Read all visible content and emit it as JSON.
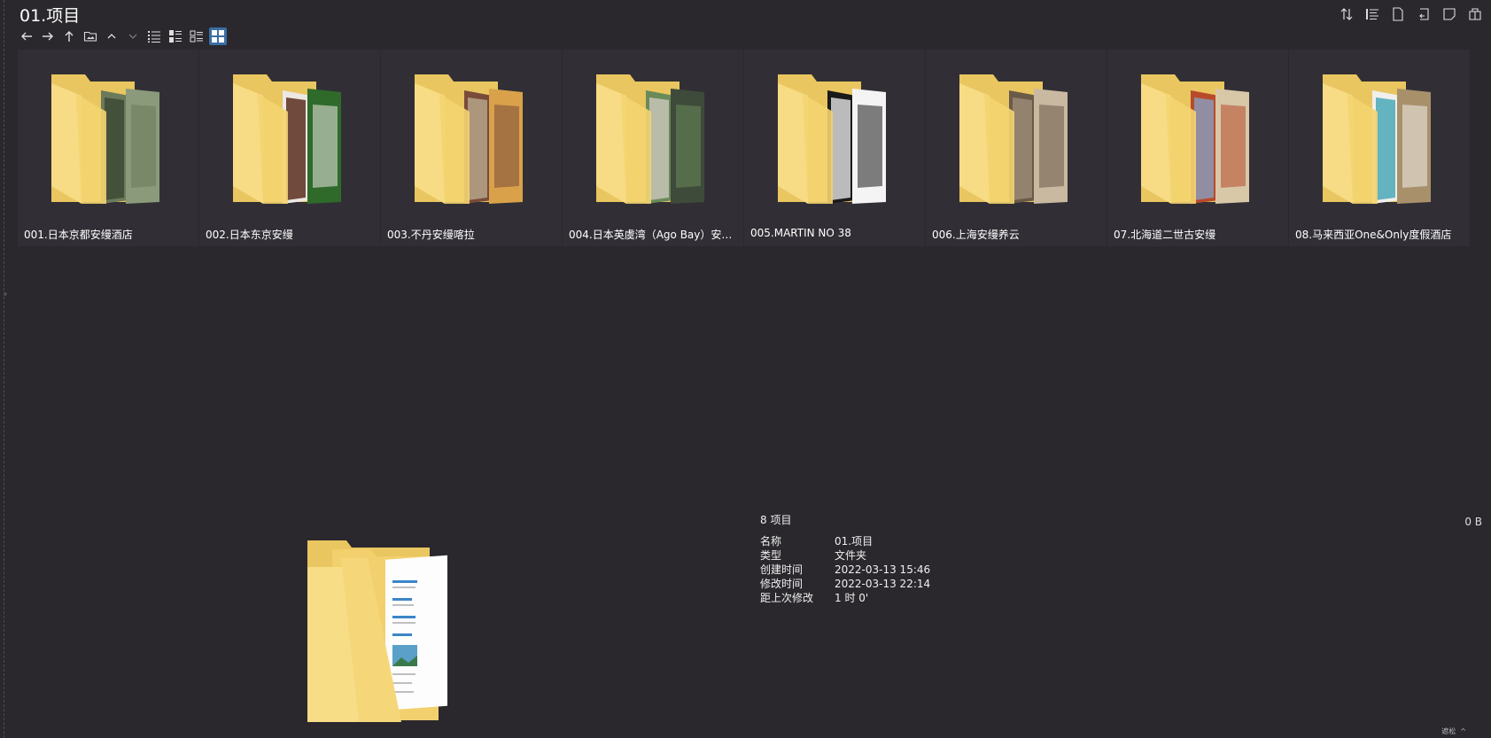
{
  "window": {
    "title": "01.项目"
  },
  "toolbar": {
    "nav_icons": [
      "back-arrow-icon",
      "forward-arrow-icon",
      "up-arrow-icon",
      "folder-picture-icon",
      "chevron-up-icon",
      "chevron-down-icon",
      "list-view-icon",
      "details-view-icon",
      "tiles-view-icon",
      "large-icons-view-icon"
    ],
    "right_icons": [
      "sort-icon",
      "properties-list-icon",
      "new-file-icon",
      "copy-path-icon",
      "note-icon",
      "package-icon"
    ]
  },
  "folders": [
    {
      "name": "001.日本京都安缦酒店",
      "colors": [
        "#6a7a5a",
        "#3d4a35",
        "#8a9a7a"
      ]
    },
    {
      "name": "002.日本东京安缦",
      "colors": [
        "#ece8e4",
        "#5a2e1e",
        "#2f6a2a"
      ]
    },
    {
      "name": "003.不丹安缦喀拉",
      "colors": [
        "#7a4a3a",
        "#b5a58a",
        "#d9a24a"
      ]
    },
    {
      "name": "004.日本英虞湾（Ago Bay）安缦...",
      "colors": [
        "#6a8a5a",
        "#c8c4b8",
        "#3e4a3a"
      ]
    },
    {
      "name": "005.MARTIN NO 38",
      "colors": [
        "#1a1a1a",
        "#d8d8d8",
        "#f4f4f4"
      ]
    },
    {
      "name": "006.上海安缦养云",
      "colors": [
        "#6a5a48",
        "#9a8a74",
        "#c9b9a0"
      ]
    },
    {
      "name": "07.北海道二世古安缦",
      "colors": [
        "#b84a2a",
        "#8a9ab8",
        "#d8c8a8"
      ]
    },
    {
      "name": "08.马来西亚One&Only度假酒店",
      "colors": [
        "#f0efeb",
        "#4aa8b8",
        "#a8906a"
      ]
    }
  ],
  "details": {
    "count": "8 项目",
    "size": "0 B",
    "rows": [
      {
        "key": "名称",
        "value": "01.项目"
      },
      {
        "key": "类型",
        "value": "文件夹"
      },
      {
        "key": "创建时间",
        "value": "2022-03-13  15:46"
      },
      {
        "key": "修改时间",
        "value": "2022-03-13  22:14"
      },
      {
        "key": "距上次修改",
        "value": "1 时 0'"
      }
    ]
  },
  "status": {
    "text": "遮松"
  }
}
